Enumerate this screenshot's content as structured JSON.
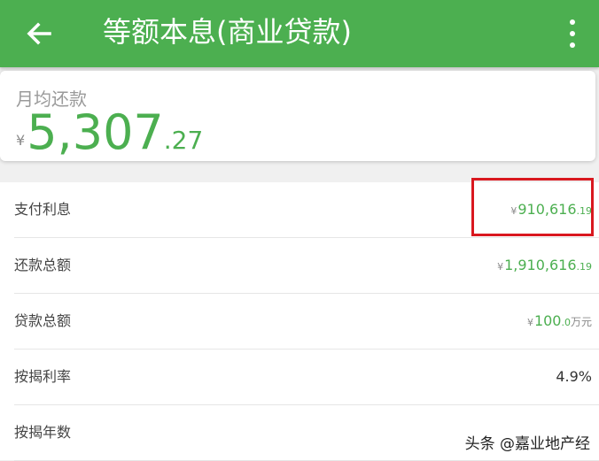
{
  "appbar": {
    "title": "等额本息(商业贷款)",
    "back_icon": "arrow-left-icon",
    "menu_icon": "more-vertical-icon"
  },
  "summary": {
    "label": "月均还款",
    "currency": "¥",
    "amount_int": "5,307",
    "amount_dec": ".27"
  },
  "rows": [
    {
      "label": "支付利息",
      "currency": "¥",
      "int": "910,616",
      "dec": ".19",
      "unit": ""
    },
    {
      "label": "还款总额",
      "currency": "¥",
      "int": "1,910,616",
      "dec": ".19",
      "unit": ""
    },
    {
      "label": "贷款总额",
      "currency": "¥",
      "int": "100",
      "dec": ".0",
      "unit": "万元"
    },
    {
      "label": "按揭利率",
      "text": "4.9%"
    },
    {
      "label": "按揭年数",
      "text": ""
    }
  ],
  "watermark": "头条 @嘉业地产经",
  "colors": {
    "brand": "#4caf50",
    "highlight": "#d9181f"
  }
}
